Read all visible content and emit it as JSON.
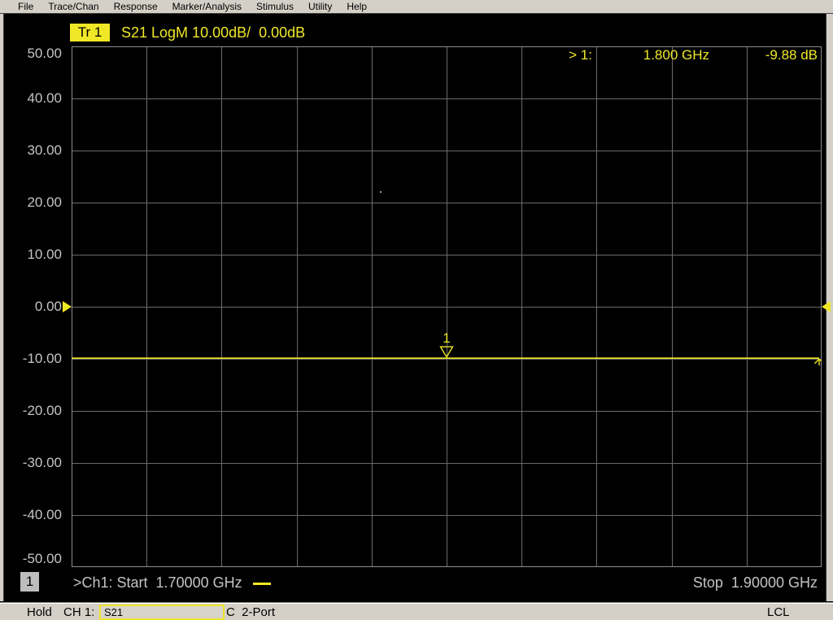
{
  "menu": {
    "items": [
      "File",
      "Trace/Chan",
      "Response",
      "Marker/Analysis",
      "Stimulus",
      "Utility",
      "Help"
    ]
  },
  "trace_header": {
    "trace_id": "Tr 1",
    "settings": "S21 LogM 10.00dB/  0.00dB"
  },
  "marker_readout": {
    "marker_label": "> 1:",
    "frequency": "1.800 GHz",
    "value": "-9.88 dB"
  },
  "chart": {
    "type": "line",
    "y_ticks": [
      "50.00",
      "40.00",
      "30.00",
      "20.00",
      "10.00",
      "0.00",
      "-10.00",
      "-20.00",
      "-30.00",
      "-40.00",
      "-50.00"
    ],
    "y_max_db": 50,
    "y_min_db": -50,
    "scale_per_div_db": 10.0,
    "reference_level_db": 0.0,
    "x_start_ghz": 1.7,
    "x_stop_ghz": 1.9,
    "x_divisions": 10,
    "trace_value_db": -9.88,
    "marker_number": "1",
    "marker_freq_ghz": 1.8
  },
  "stimulus_bar": {
    "channel_number": "1",
    "start_text": ">Ch1: Start  1.70000 GHz",
    "stop_text": "Stop  1.90000 GHz"
  },
  "status_bar": {
    "sweep_state": "Hold",
    "channel_label": "CH 1:",
    "measurement": "S21",
    "cal_status": "C  2-Port",
    "control_mode": "LCL"
  },
  "colors": {
    "accent_yellow": "#f0e826",
    "grid_line": "#6a6a6a",
    "grid_border": "#8e8e8e",
    "label_gray": "#c4c4c4",
    "chrome_gray": "#d4d0c8"
  }
}
